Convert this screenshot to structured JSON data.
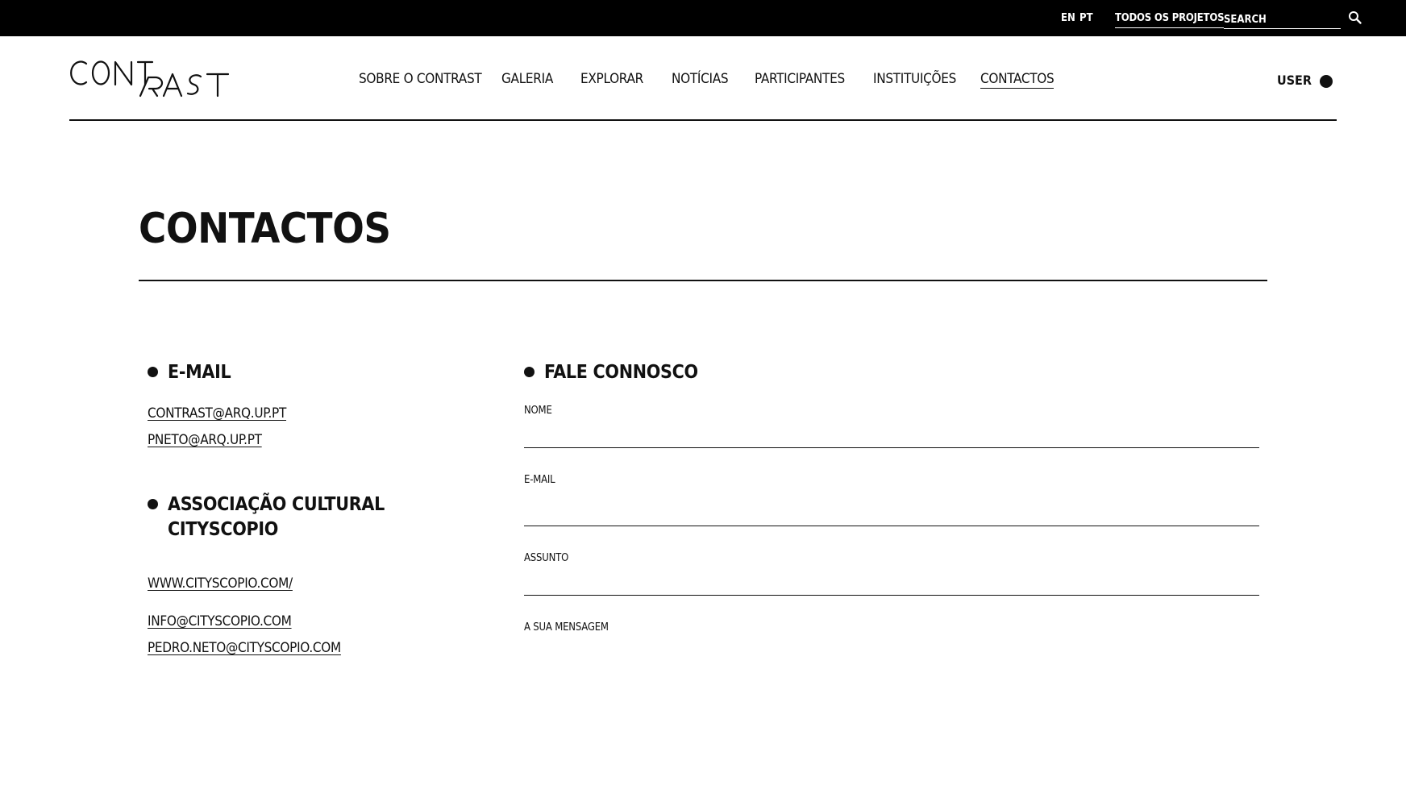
{
  "topbar": {
    "lang_en": "EN",
    "lang_pt": "PT",
    "all_projects": "TODOS OS PROJETOS",
    "search_placeholder": "SEARCH",
    "search_icon": "search-icon"
  },
  "header": {
    "logo_text": "CONTRAST",
    "nav": [
      {
        "label": "SOBRE O CONTRAST"
      },
      {
        "label": "GALERIA"
      },
      {
        "label": "EXPLORAR"
      },
      {
        "label": "NOTÍCIAS"
      },
      {
        "label": "PARTICIPANTES"
      },
      {
        "label": "INSTITUIÇÕES"
      },
      {
        "label": "CONTACTOS",
        "active": true
      }
    ],
    "user_label": "USER"
  },
  "page": {
    "title": "CONTACTOS"
  },
  "contacts": {
    "email_heading": "E-MAIL",
    "emails": [
      "CONTRAST@ARQ.UP.PT",
      "PNETO@ARQ.UP.PT"
    ],
    "association_heading_line1": "ASSOCIAÇÃO CULTURAL",
    "association_heading_line2": "CITYSCOPIO",
    "website": "WWW.CITYSCOPIO.COM/",
    "association_emails": [
      "INFO@CITYSCOPIO.COM",
      "PEDRO.NETO@CITYSCOPIO.COM"
    ]
  },
  "form": {
    "heading": "FALE CONNOSCO",
    "name_label": "NOME",
    "email_label": "E-MAIL",
    "subject_label": "ASSUNTO",
    "message_label": "A SUA MENSAGEM"
  },
  "colors": {
    "topbar_bg": "#000000",
    "text": "#111111",
    "background": "#ffffff"
  }
}
